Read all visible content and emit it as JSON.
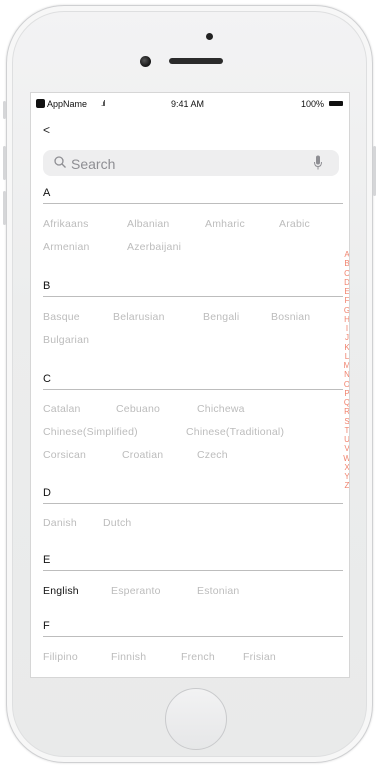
{
  "status_bar": {
    "carrier": "AppName",
    "signal": ".ıl",
    "time": "9:41 AM",
    "battery": "100%"
  },
  "nav": {
    "back_label": "<"
  },
  "search": {
    "placeholder": "Search"
  },
  "sections": [
    {
      "letter": "A",
      "languages": [
        "Afrikaans",
        "Albanian",
        "Amharic",
        "Arabic",
        "Armenian",
        "Azerbaijani"
      ]
    },
    {
      "letter": "B",
      "languages": [
        "Basque",
        "Belarusian",
        "Bengali",
        "Bosnian",
        "Bulgarian"
      ]
    },
    {
      "letter": "C",
      "languages": [
        "Catalan",
        "Cebuano",
        "Chichewa",
        "Chinese(Simplified)",
        "Chinese(Traditional)",
        "Corsican",
        "Croatian",
        "Czech"
      ]
    },
    {
      "letter": "D",
      "languages": [
        "Danish",
        "Dutch"
      ]
    },
    {
      "letter": "E",
      "languages": [
        "English",
        "Esperanto",
        "Estonian"
      ]
    },
    {
      "letter": "F",
      "languages": [
        "Filipino",
        "Finnish",
        "French",
        "Frisian"
      ]
    }
  ],
  "selected_language": "English",
  "index_letters": [
    "A",
    "B",
    "C",
    "D",
    "E",
    "F",
    "G",
    "H",
    "I",
    "J",
    "K",
    "L",
    "M",
    "N",
    "O",
    "P",
    "Q",
    "R",
    "S",
    "T",
    "U",
    "V",
    "W",
    "X",
    "Y",
    "Z"
  ],
  "colors": {
    "index": "#f0826d",
    "inactive": "#bcbcbc",
    "active": "#111111",
    "search_bg": "#eeeeef"
  }
}
